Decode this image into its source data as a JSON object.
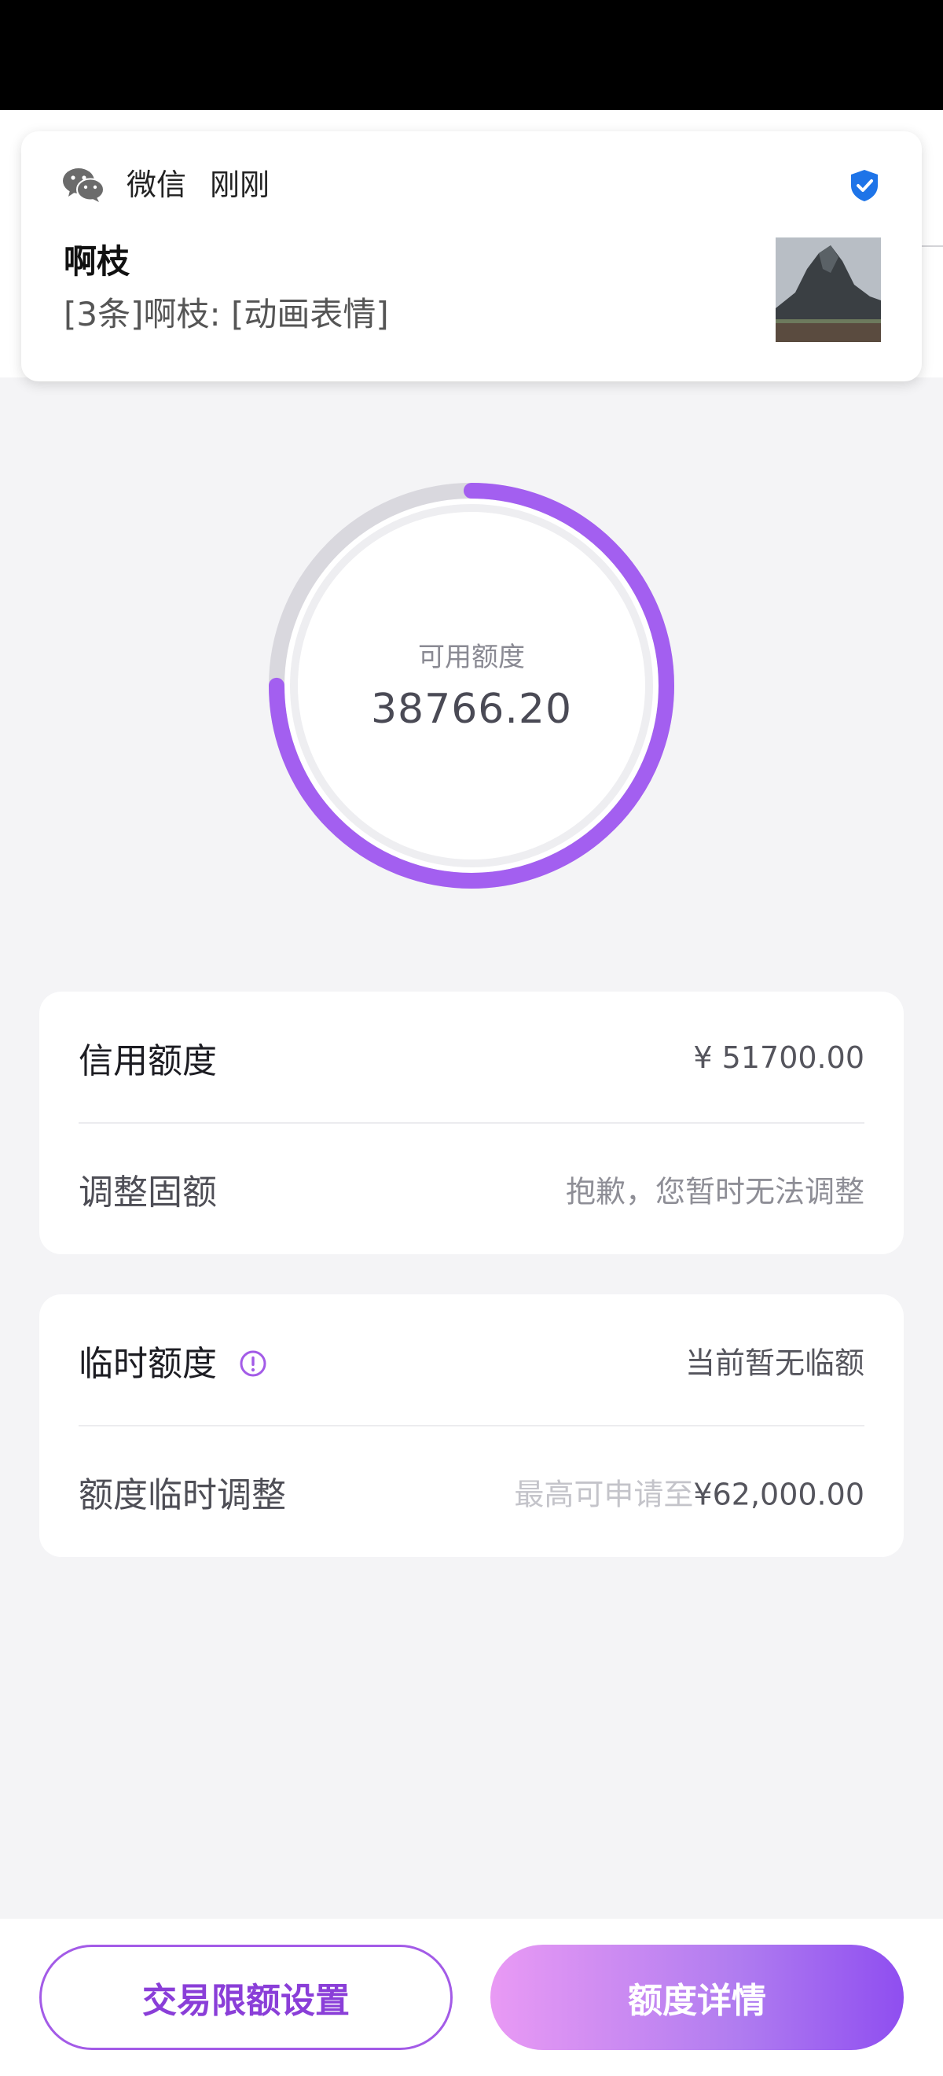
{
  "notification": {
    "app_name": "微信",
    "time": "刚刚",
    "sender": "啊枝",
    "message": "[3条]啊枝: [动画表情]",
    "app_icon": "wechat-icon",
    "verified_icon": "shield-check-icon"
  },
  "ring": {
    "label": "可用额度",
    "value": "38766.20",
    "fraction_available": 0.75,
    "progress_color": "#a35ff0",
    "track_color": "#d9d8de"
  },
  "limit_card": {
    "credit_label": "信用额度",
    "credit_value": "¥ 51700.00",
    "adjust_label": "调整固额",
    "adjust_value": "抱歉，您暂时无法调整"
  },
  "temp_card": {
    "temp_label": "临时额度",
    "temp_value": "当前暂无临额",
    "temp_adjust_label": "额度临时调整",
    "temp_adjust_hint": "最高可申请至",
    "temp_adjust_amount": "¥62,000.00",
    "info_icon": "info-circle-icon"
  },
  "buttons": {
    "limit_settings": "交易限额设置",
    "limit_details": "额度详情"
  },
  "colors": {
    "accent": "#a35be7",
    "background": "#f4f4f6"
  }
}
